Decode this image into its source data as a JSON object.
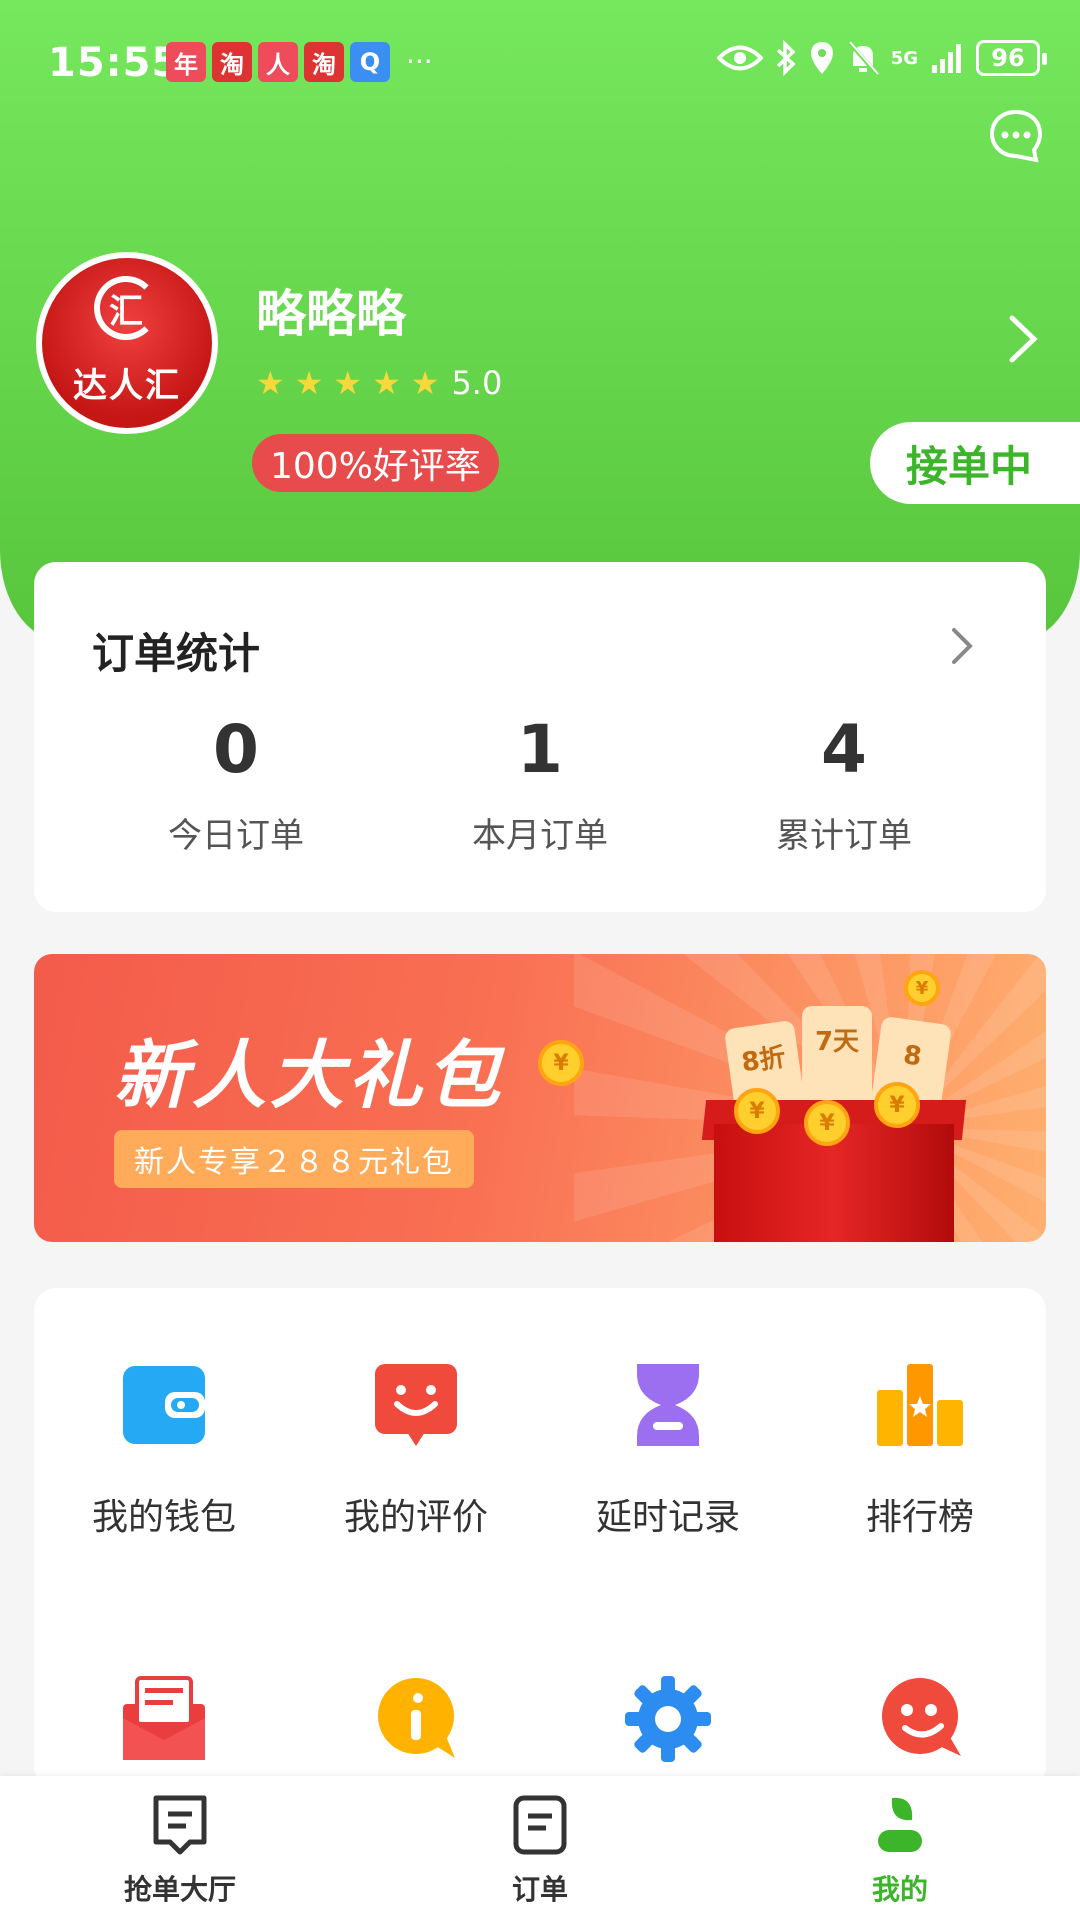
{
  "status_bar": {
    "time": "15:55",
    "app_icons": [
      {
        "name": "nianhuo-icon",
        "glyph": "年"
      },
      {
        "name": "taobao-icon-1",
        "glyph": "淘"
      },
      {
        "name": "app-icon-3",
        "glyph": "人"
      },
      {
        "name": "taobao-icon-2",
        "glyph": "淘"
      },
      {
        "name": "app-icon-5",
        "glyph": "Q"
      }
    ],
    "more": "···",
    "network": "5G",
    "battery": "96"
  },
  "profile": {
    "avatar_logo_char": "汇",
    "avatar_text": "达人汇",
    "name": "略略略",
    "stars": [
      "★",
      "★",
      "★",
      "★",
      "★"
    ],
    "rating": "5.0",
    "praise_rate": "100%好评率",
    "status": "接单中"
  },
  "order_stats": {
    "title": "订单统计",
    "items": [
      {
        "value": "0",
        "label": "今日订单"
      },
      {
        "value": "1",
        "label": "本月订单"
      },
      {
        "value": "4",
        "label": "累计订单"
      }
    ]
  },
  "banner": {
    "title": "新人大礼包",
    "subtitle": "新人专享２８８元礼包",
    "ticket1": "8折",
    "ticket2": "7天",
    "ticket3": "8",
    "coin": "¥"
  },
  "menu": {
    "items": [
      {
        "label": "我的钱包"
      },
      {
        "label": "我的评价"
      },
      {
        "label": "延时记录"
      },
      {
        "label": "排行榜"
      }
    ]
  },
  "tabbar": {
    "items": [
      {
        "label": "抢单大厅"
      },
      {
        "label": "订单"
      },
      {
        "label": "我的"
      }
    ]
  },
  "colors": {
    "header_green": "#6ae052",
    "accent_green": "#3db52a",
    "badge_red": "#e84b4b",
    "star_yellow": "#f8d83a"
  }
}
